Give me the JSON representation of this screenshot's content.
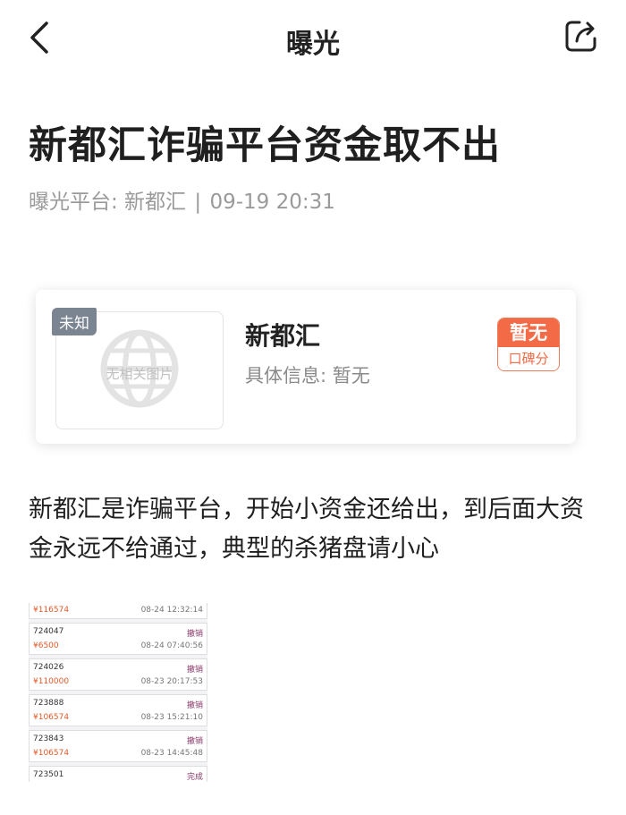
{
  "nav": {
    "title": "曝光",
    "back_icon": "chevron-left-icon",
    "share_icon": "share-icon"
  },
  "article": {
    "title": "新都汇诈骗平台资金取不出",
    "meta_source": "曝光平台:  新都汇",
    "meta_sep": "|",
    "meta_time": "09-19 20:31",
    "body": "新都汇是诈骗平台，开始小资金还给出，到后面大资金永远不给通过，典型的杀猪盘请小心"
  },
  "card": {
    "badge": "未知",
    "thumb_text": "无相关图片",
    "name": "新都汇",
    "info": "具体信息: 暂无",
    "score_value": "暂无",
    "score_label": "口碑分",
    "accent_color": "#f26a46"
  },
  "screenshot": {
    "first_row": {
      "amount": "¥116574",
      "time": "08-24 12:32:14"
    },
    "records": [
      {
        "id": "724047",
        "status": "撤销",
        "amount": "¥6500",
        "time": "08-24 07:40:56"
      },
      {
        "id": "724026",
        "status": "撤销",
        "amount": "¥110000",
        "time": "08-23 20:17:53"
      },
      {
        "id": "723888",
        "status": "撤销",
        "amount": "¥106574",
        "time": "08-23 15:21:10"
      },
      {
        "id": "723843",
        "status": "撤销",
        "amount": "¥106574",
        "time": "08-23 14:45:48"
      },
      {
        "id": "723501",
        "status": "完成",
        "amount": "",
        "time": ""
      }
    ]
  }
}
